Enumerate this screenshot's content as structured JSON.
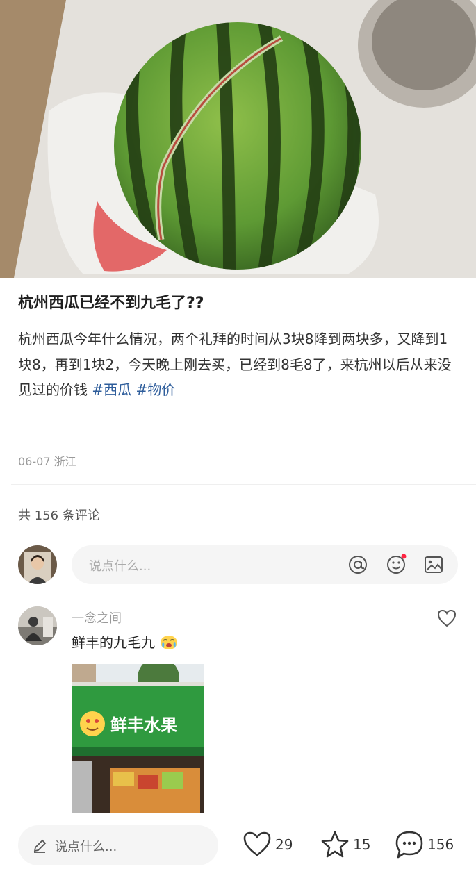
{
  "post": {
    "title": "杭州西瓜已经不到九毛了??",
    "body": "杭州西瓜今年什么情况，两个礼拜的时间从3块8降到两块多，又降到1块8，再到1块2，今天晚上刚去买，已经到8毛8了，来杭州以后从来没见过的价钱",
    "tags": [
      "#西瓜",
      "#物价"
    ],
    "date": "06-07",
    "location": "浙江"
  },
  "comments": {
    "count_label": "共 156 条评论",
    "input_placeholder": "说点什么...",
    "input_icons": [
      "at-icon",
      "emoji-icon",
      "image-icon"
    ]
  },
  "reply": {
    "author": "一念之间",
    "text": "鲜丰的九毛九",
    "emoji": "crying-face-emoji",
    "image_sign_text": "鲜丰水果"
  },
  "bottom_bar": {
    "placeholder": "说点什么...",
    "likes": "29",
    "stars": "15",
    "comments": "156"
  },
  "colors": {
    "tag": "#2e5d9b",
    "notification_dot": "#ff2442",
    "sign_green": "#2f9a3f"
  }
}
